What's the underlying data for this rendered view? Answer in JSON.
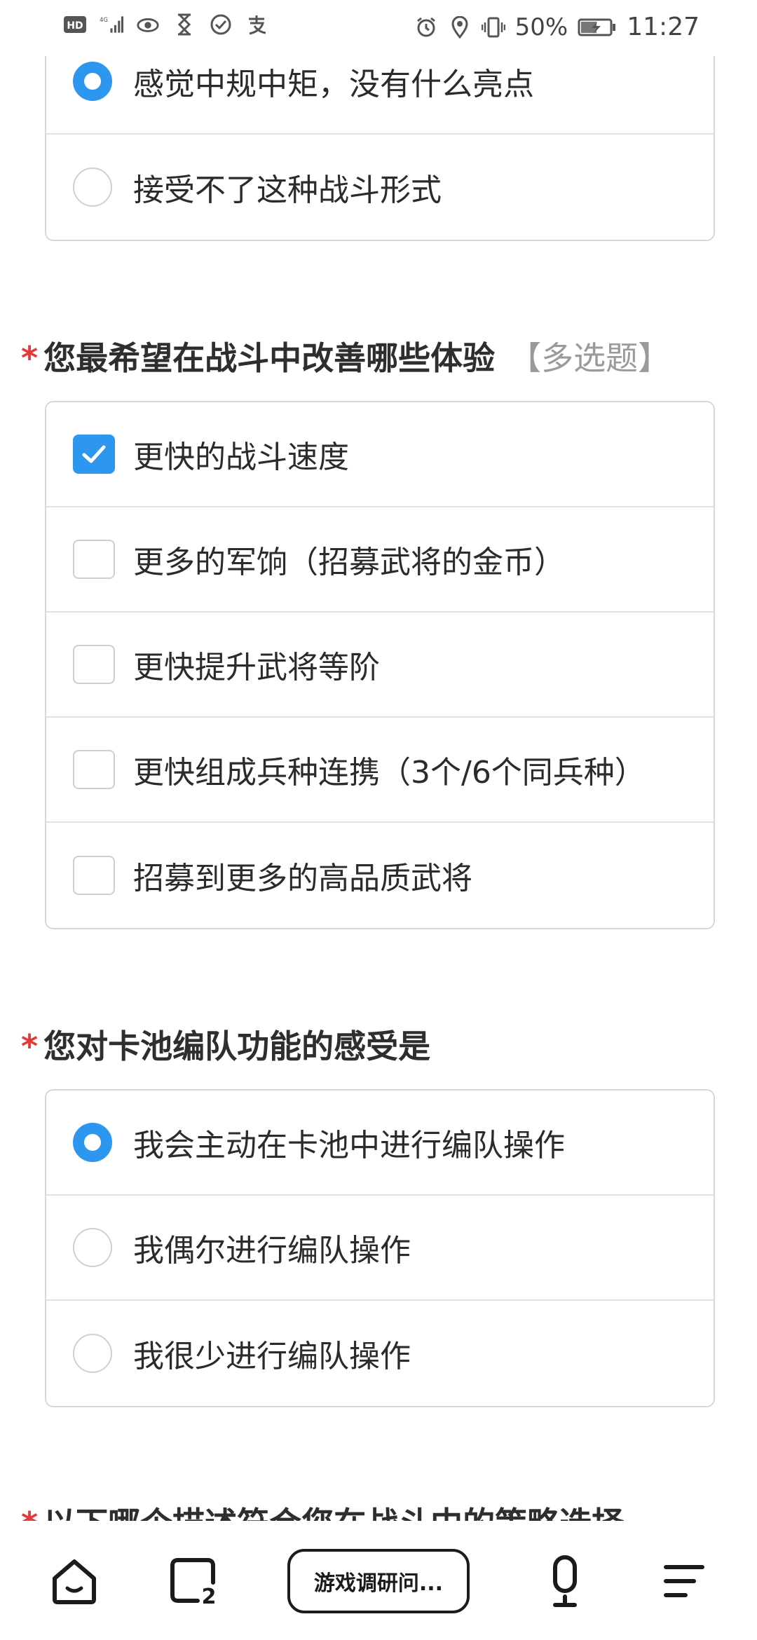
{
  "status_bar": {
    "network": "4G",
    "battery": "50%",
    "time": "11:27"
  },
  "q_prev": {
    "options": [
      {
        "label": "感觉中规中矩，没有什么亮点",
        "selected": true
      },
      {
        "label": "接受不了这种战斗形式",
        "selected": false
      }
    ]
  },
  "q_improve": {
    "required_mark": "*",
    "title": "您最希望在战斗中改善哪些体验",
    "tag": "【多选题】",
    "options": [
      {
        "label": "更快的战斗速度",
        "checked": true
      },
      {
        "label": "更多的军饷（招募武将的金币）",
        "checked": false
      },
      {
        "label": "更快提升武将等阶",
        "checked": false
      },
      {
        "label": "更快组成兵种连携（3个/6个同兵种）",
        "checked": false
      },
      {
        "label": "招募到更多的高品质武将",
        "checked": false
      }
    ]
  },
  "q_pool": {
    "required_mark": "*",
    "title": "您对卡池编队功能的感受是",
    "options": [
      {
        "label": "我会主动在卡池中进行编队操作",
        "selected": true
      },
      {
        "label": "我偶尔进行编队操作",
        "selected": false
      },
      {
        "label": "我很少进行编队操作",
        "selected": false
      }
    ]
  },
  "q_strategy": {
    "required_mark": "*",
    "title": "以下哪个描述符合您在战斗中的策略选择"
  },
  "bottom_bar": {
    "tab_count": "2",
    "page_title": "游戏调研问..."
  },
  "colors": {
    "accent": "#2d97f0",
    "required": "#e53935",
    "tag": "#9a9a9a"
  }
}
